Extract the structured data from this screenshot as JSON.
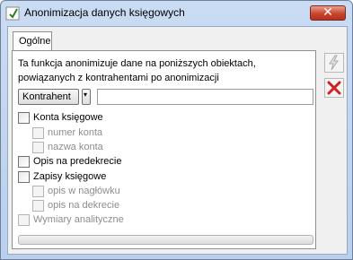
{
  "window": {
    "title": "Anonimizacja danych księgowych",
    "close_symbol": "✕"
  },
  "tabs": [
    {
      "label": "Ogólne",
      "active": true
    }
  ],
  "description": "Ta funkcja anonimizuje dane na poniższych obiektach, powiązanych z kontrahentami po anonimizacji",
  "object_selector": {
    "selected": "Kontrahent",
    "arrow": "▾"
  },
  "search_value": "",
  "options": {
    "konta": {
      "label": "Konta księgowe",
      "checked": false,
      "enabled": true
    },
    "numer_konta": {
      "label": "numer konta",
      "checked": false,
      "enabled": false
    },
    "nazwa_konta": {
      "label": "nazwa konta",
      "checked": false,
      "enabled": false
    },
    "opis_predekrecie": {
      "label": "Opis na predekrecie",
      "checked": false,
      "enabled": true
    },
    "zapisy": {
      "label": "Zapisy księgowe",
      "checked": false,
      "enabled": true
    },
    "opis_naglowek": {
      "label": "opis w nagłówku",
      "checked": false,
      "enabled": false
    },
    "opis_dekrecie": {
      "label": "opis na dekrecie",
      "checked": false,
      "enabled": false
    },
    "wymiary": {
      "label": "Wymiary analityczne",
      "checked": false,
      "enabled": false
    }
  },
  "progress": 0,
  "side_buttons": [
    {
      "icon": "lightning-icon",
      "enabled": false
    },
    {
      "icon": "cross-icon",
      "enabled": true
    }
  ],
  "colors": {
    "cancel_red": "#d21e1e",
    "titlebar": "#c4d8f2"
  }
}
